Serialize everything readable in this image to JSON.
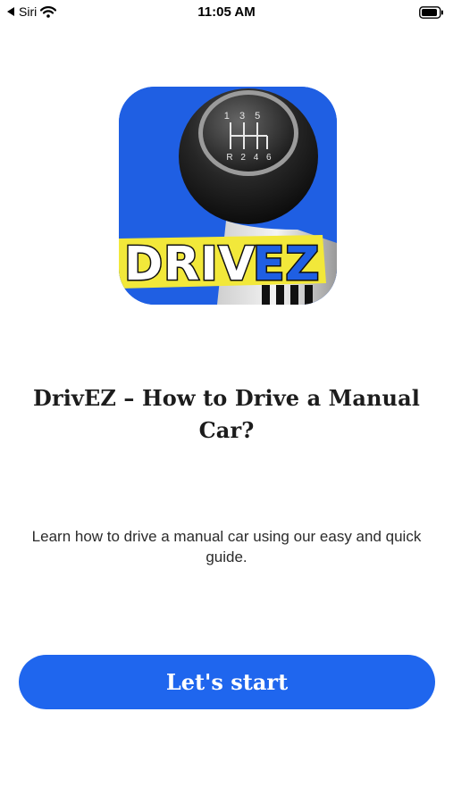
{
  "status_bar": {
    "carrier": "Siri",
    "time": "11:05 AM"
  },
  "app_icon": {
    "shift_pattern_top": "1 3 5",
    "shift_pattern_bottom": "R 2 4 6",
    "logo_text_left": "DRIV",
    "logo_text_right": "EZ"
  },
  "content": {
    "title": "DrivEZ – How to Drive a Manual Car?",
    "subtitle": "Learn how to drive a manual car using our easy and quick guide.",
    "start_button": "Let's start"
  },
  "colors": {
    "accent": "#1f66ee",
    "icon_background": "#1f5fe3",
    "logo_yellow": "#f2e83a"
  },
  "icons": [
    "back-arrow-icon",
    "wifi-icon",
    "battery-icon"
  ]
}
